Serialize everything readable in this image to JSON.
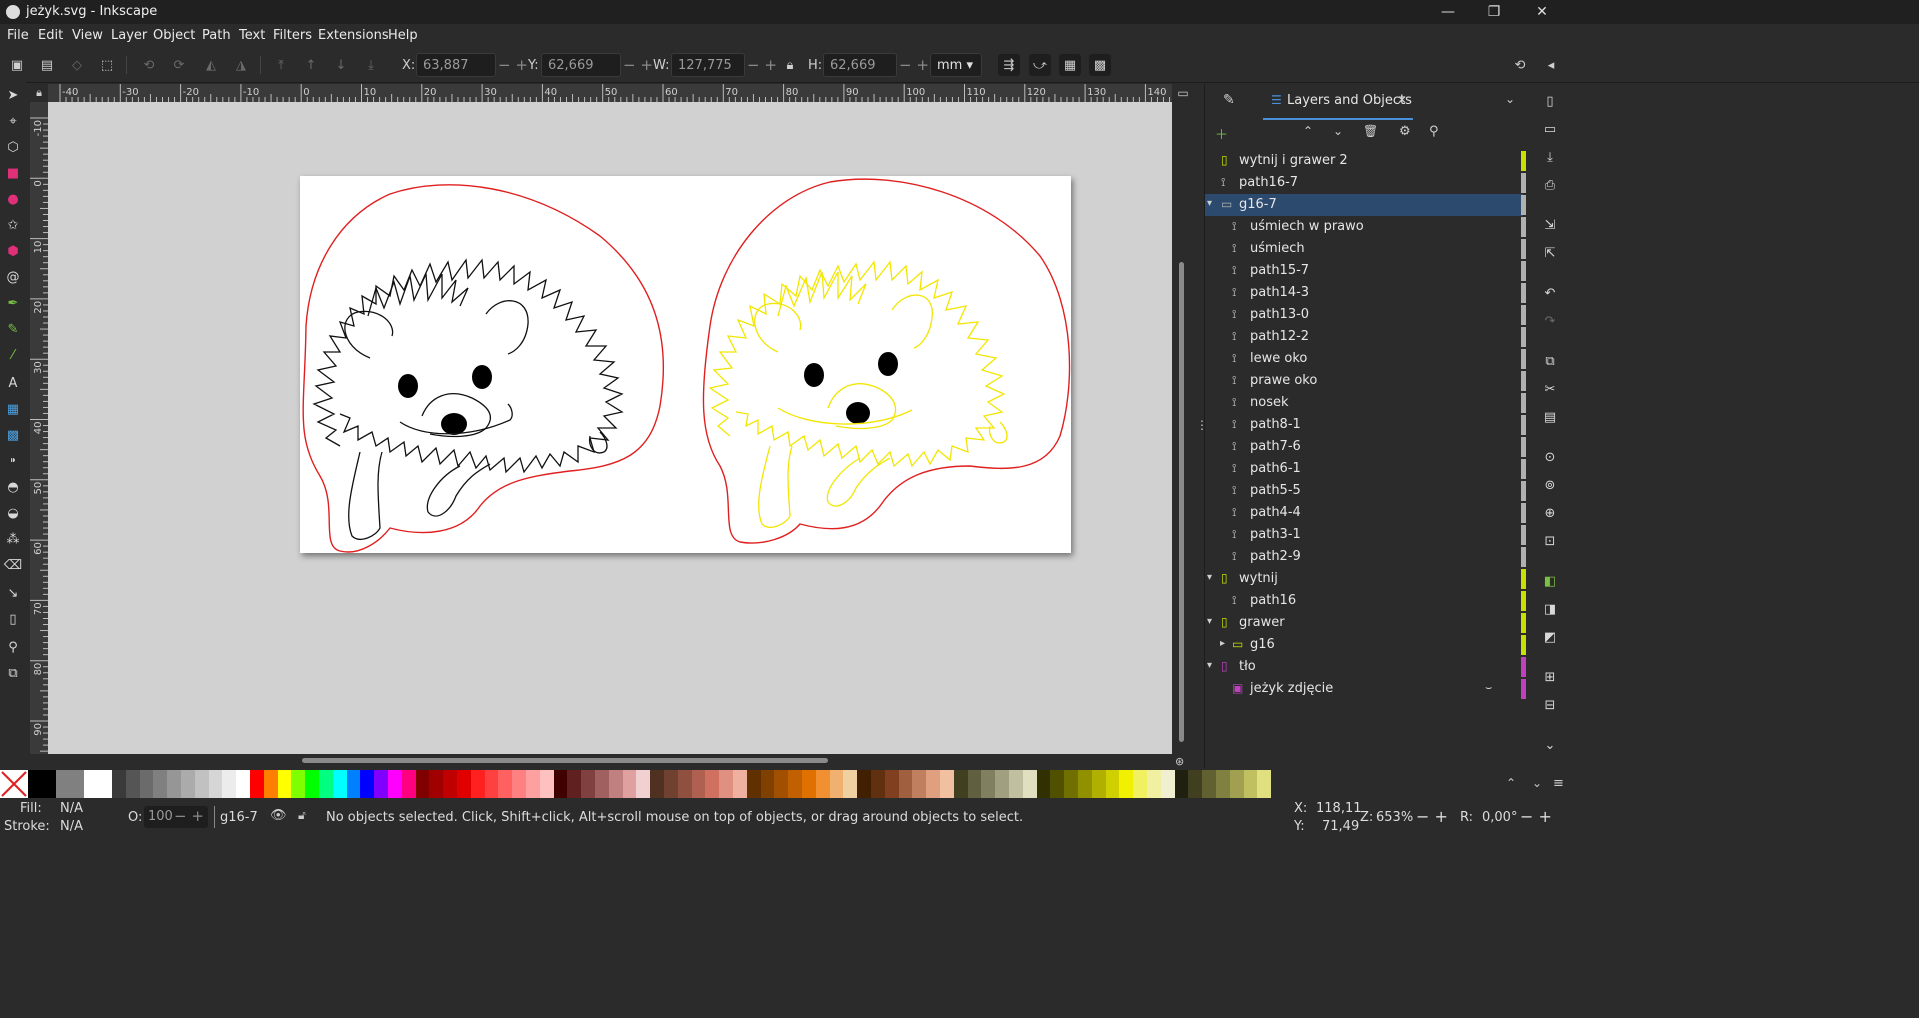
{
  "window": {
    "title": "jeżyk.svg - Inkscape"
  },
  "menu": [
    "File",
    "Edit",
    "View",
    "Layer",
    "Object",
    "Path",
    "Text",
    "Filters",
    "Extensions",
    "Help"
  ],
  "controls": {
    "x_label": "X:",
    "x_value": "63,887",
    "y_label": "Y:",
    "y_value": "62,669",
    "w_label": "W:",
    "w_value": "127,775",
    "h_label": "H:",
    "h_value": "62,669",
    "unit": "mm"
  },
  "ruler": {
    "h_labels": [
      "-40",
      "-30",
      "-20",
      "-10",
      "0",
      "10",
      "20",
      "30",
      "40",
      "50",
      "60",
      "70",
      "80",
      "90",
      "100",
      "110",
      "120",
      "130",
      "140"
    ],
    "v_labels": [
      "-10",
      "0",
      "10",
      "20",
      "30",
      "40",
      "50",
      "60",
      "70",
      "80",
      "90"
    ]
  },
  "panel": {
    "tab_title": "Layers and Objects",
    "rows": [
      {
        "label": "wytnij i grawer 2",
        "type": "layer",
        "depth": 0,
        "arrow": "",
        "color": "#c8e000"
      },
      {
        "label": "path16-7",
        "type": "path",
        "depth": 0,
        "arrow": "",
        "color": "#b0b0b0"
      },
      {
        "label": "g16-7",
        "type": "group",
        "depth": 0,
        "arrow": "▾",
        "color": "#b0b0b0",
        "selected": true
      },
      {
        "label": "uśmiech w prawo",
        "type": "path",
        "depth": 1,
        "arrow": "",
        "color": "#b0b0b0"
      },
      {
        "label": "uśmiech",
        "type": "path",
        "depth": 1,
        "arrow": "",
        "color": "#b0b0b0"
      },
      {
        "label": "path15-7",
        "type": "path",
        "depth": 1,
        "arrow": "",
        "color": "#b0b0b0"
      },
      {
        "label": "path14-3",
        "type": "path",
        "depth": 1,
        "arrow": "",
        "color": "#b0b0b0"
      },
      {
        "label": "path13-0",
        "type": "path",
        "depth": 1,
        "arrow": "",
        "color": "#b0b0b0"
      },
      {
        "label": "path12-2",
        "type": "path",
        "depth": 1,
        "arrow": "",
        "color": "#b0b0b0"
      },
      {
        "label": "lewe oko",
        "type": "path",
        "depth": 1,
        "arrow": "",
        "color": "#b0b0b0"
      },
      {
        "label": "prawe oko",
        "type": "path",
        "depth": 1,
        "arrow": "",
        "color": "#b0b0b0"
      },
      {
        "label": "nosek",
        "type": "path",
        "depth": 1,
        "arrow": "",
        "color": "#b0b0b0"
      },
      {
        "label": "path8-1",
        "type": "path",
        "depth": 1,
        "arrow": "",
        "color": "#b0b0b0"
      },
      {
        "label": "path7-6",
        "type": "path",
        "depth": 1,
        "arrow": "",
        "color": "#b0b0b0"
      },
      {
        "label": "path6-1",
        "type": "path",
        "depth": 1,
        "arrow": "",
        "color": "#b0b0b0"
      },
      {
        "label": "path5-5",
        "type": "path",
        "depth": 1,
        "arrow": "",
        "color": "#b0b0b0"
      },
      {
        "label": "path4-4",
        "type": "path",
        "depth": 1,
        "arrow": "",
        "color": "#b0b0b0"
      },
      {
        "label": "path3-1",
        "type": "path",
        "depth": 1,
        "arrow": "",
        "color": "#b0b0b0"
      },
      {
        "label": "path2-9",
        "type": "path",
        "depth": 1,
        "arrow": "",
        "color": "#b0b0b0"
      },
      {
        "label": "wytnij",
        "type": "layer",
        "depth": 0,
        "arrow": "▾",
        "color": "#c8e000"
      },
      {
        "label": "path16",
        "type": "path",
        "depth": 1,
        "arrow": "",
        "color": "#c8e000"
      },
      {
        "label": "grawer",
        "type": "layer",
        "depth": 0,
        "arrow": "▾",
        "color": "#c8e000"
      },
      {
        "label": "g16",
        "type": "group",
        "depth": 1,
        "arrow": "▸",
        "color": "#c8e000"
      },
      {
        "label": "tło",
        "type": "layer",
        "depth": 0,
        "arrow": "▾",
        "color": "#c040c0"
      },
      {
        "label": "jeżyk zdjęcie",
        "type": "image",
        "depth": 1,
        "arrow": "",
        "color": "#c040c0"
      }
    ]
  },
  "palette": [
    "#000000",
    "#808080",
    "#ffffff",
    "#3a3a3a",
    "#555555",
    "#6b6b6b",
    "#808080",
    "#969696",
    "#ababab",
    "#c1c1c1",
    "#d6d6d6",
    "#ececec",
    "#ffffff",
    "#ff0000",
    "#ff8000",
    "#ffff00",
    "#80ff00",
    "#00ff00",
    "#00ff80",
    "#00ffff",
    "#0080ff",
    "#0000ff",
    "#8000ff",
    "#ff00ff",
    "#ff0080",
    "#800000",
    "#a00000",
    "#c00000",
    "#e00000",
    "#ff2020",
    "#ff4040",
    "#ff6060",
    "#ff8080",
    "#ffa0a0",
    "#ffc0c0",
    "#400000",
    "#602020",
    "#804040",
    "#a06060",
    "#c08080",
    "#e0a0a0",
    "#f0d0d0",
    "#503020",
    "#704030",
    "#905040",
    "#b06050",
    "#d07060",
    "#e09080",
    "#f0b0a0",
    "#603000",
    "#804000",
    "#a05000",
    "#c06000",
    "#e07000",
    "#f09030",
    "#f0b070",
    "#f0d0a0",
    "#402000",
    "#603010",
    "#804020",
    "#a06040",
    "#c08060",
    "#e0a080",
    "#f0c0a0",
    "#404020",
    "#606040",
    "#808060",
    "#a0a080",
    "#c0c0a0",
    "#e0e0c0",
    "#303000",
    "#505000",
    "#707000",
    "#909000",
    "#b0b000",
    "#d0d000",
    "#f0f000",
    "#f0f060",
    "#f0f0a0",
    "#f0f0d0",
    "#202010",
    "#404020",
    "#606030",
    "#808040",
    "#a0a050",
    "#c0c060",
    "#e0e080"
  ],
  "status": {
    "fill_label": "Fill:",
    "fill_value": "N/A",
    "stroke_label": "Stroke:",
    "stroke_value": "N/A",
    "opacity_label": "O:",
    "opacity_value": "100",
    "layer_name": "g16-7",
    "message": "No objects selected. Click, Shift+click, Alt+scroll mouse on top of objects, or drag around objects to select.",
    "x_label": "X:",
    "x_value": "118,11",
    "y_label": "Y:",
    "y_value": "71,49",
    "zoom_label": "Z:",
    "zoom_value": "653%",
    "rot_label": "R:",
    "rot_value": "0,00°"
  }
}
